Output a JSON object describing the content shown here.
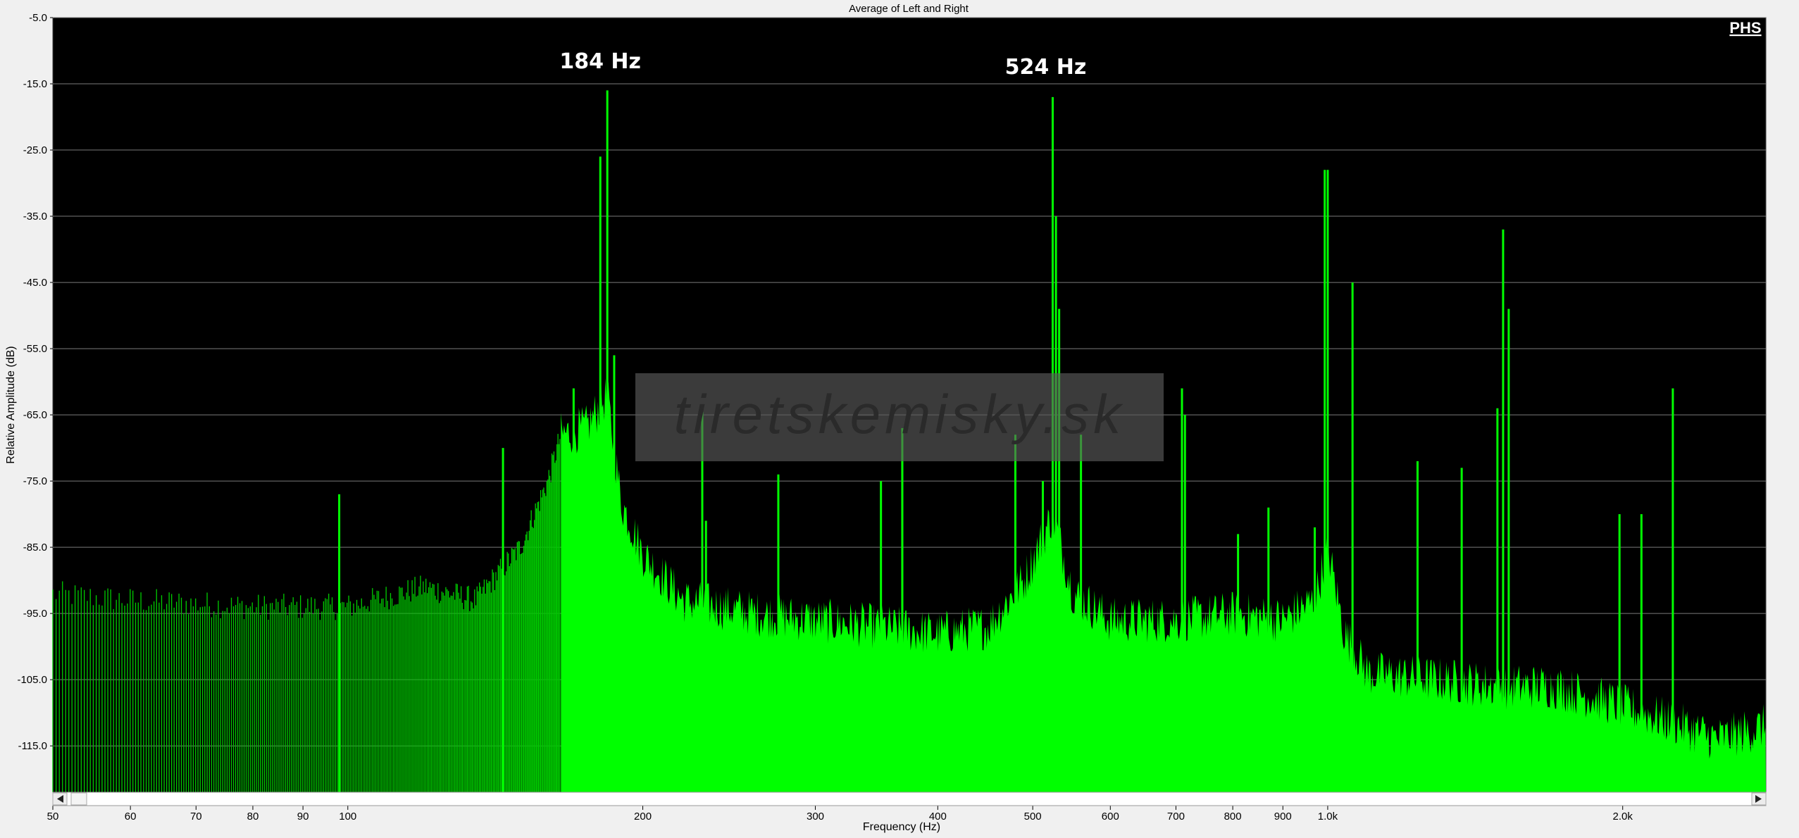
{
  "window": {
    "title": "Average of Left and Right"
  },
  "badge": "PHS",
  "watermark": "tiretskemisky.sk",
  "annotations": [
    {
      "text": "184 Hz",
      "x": 184
    },
    {
      "text": "524 Hz",
      "x": 524
    }
  ],
  "colors": {
    "plot_background": "#000000",
    "spectrum_fill": "#00ff00",
    "spectrum_low_region": "#00cc00",
    "grid": "#7a7a7a",
    "window_background": "#f0f0f0"
  },
  "chart_data": {
    "type": "area",
    "title": "Average of Left and Right",
    "xlabel": "Frequency (Hz)",
    "ylabel": "Relative Amplitude (dB)",
    "x_scale": "log",
    "xlim": [
      50,
      2800
    ],
    "ylim": [
      -122,
      -5
    ],
    "grid": true,
    "yticks": [
      -5,
      -15,
      -25,
      -35,
      -45,
      -55,
      -65,
      -75,
      -85,
      -95,
      -105,
      -115
    ],
    "ytick_labels": [
      "-5.0",
      "-15.0",
      "-25.0",
      "-35.0",
      "-45.0",
      "-55.0",
      "-65.0",
      "-75.0",
      "-85.0",
      "-95.0",
      "-105.0",
      "-115.0"
    ],
    "xticks": [
      50,
      60,
      70,
      80,
      90,
      100,
      200,
      300,
      400,
      500,
      600,
      700,
      800,
      900,
      1000,
      2000
    ],
    "xtick_labels": [
      "50",
      "60",
      "70",
      "80",
      "90",
      "100",
      "200",
      "300",
      "400",
      "500",
      "600",
      "700",
      "800",
      "900",
      "1.0k",
      "2.0k"
    ],
    "series": [
      {
        "name": "",
        "noise_floor": [
          [
            50,
            -92
          ],
          [
            60,
            -93
          ],
          [
            80,
            -94
          ],
          [
            100,
            -94
          ],
          [
            120,
            -91
          ],
          [
            135,
            -93
          ],
          [
            150,
            -85
          ],
          [
            160,
            -75
          ],
          [
            165,
            -68
          ],
          [
            175,
            -67
          ],
          [
            184,
            -62
          ],
          [
            190,
            -78
          ],
          [
            200,
            -86
          ],
          [
            220,
            -93
          ],
          [
            260,
            -95
          ],
          [
            300,
            -96
          ],
          [
            350,
            -97
          ],
          [
            400,
            -98
          ],
          [
            450,
            -97
          ],
          [
            490,
            -90
          ],
          [
            524,
            -80
          ],
          [
            550,
            -92
          ],
          [
            600,
            -96
          ],
          [
            700,
            -96
          ],
          [
            800,
            -95
          ],
          [
            900,
            -96
          ],
          [
            970,
            -93
          ],
          [
            1000,
            -85
          ],
          [
            1040,
            -98
          ],
          [
            1100,
            -104
          ],
          [
            1300,
            -105
          ],
          [
            1500,
            -106
          ],
          [
            1700,
            -106
          ],
          [
            1900,
            -108
          ],
          [
            2100,
            -110
          ],
          [
            2300,
            -112
          ],
          [
            2500,
            -114
          ],
          [
            2800,
            -112
          ]
        ],
        "peaks": [
          [
            98,
            -77
          ],
          [
            144,
            -70
          ],
          [
            170,
            -61
          ],
          [
            184,
            -16
          ],
          [
            181,
            -26
          ],
          [
            187,
            -56
          ],
          [
            230,
            -64
          ],
          [
            232,
            -81
          ],
          [
            275,
            -74
          ],
          [
            350,
            -75
          ],
          [
            368,
            -67
          ],
          [
            368,
            -71
          ],
          [
            480,
            -68
          ],
          [
            512,
            -75
          ],
          [
            524,
            -17
          ],
          [
            528,
            -35
          ],
          [
            532,
            -49
          ],
          [
            560,
            -68
          ],
          [
            710,
            -61
          ],
          [
            715,
            -65
          ],
          [
            810,
            -83
          ],
          [
            870,
            -79
          ],
          [
            970,
            -82
          ],
          [
            993,
            -28
          ],
          [
            1000,
            -28
          ],
          [
            1060,
            -45
          ],
          [
            1235,
            -72
          ],
          [
            1370,
            -73
          ],
          [
            1490,
            -64
          ],
          [
            1510,
            -37
          ],
          [
            1530,
            -49
          ],
          [
            1985,
            -80
          ],
          [
            2090,
            -80
          ],
          [
            2250,
            -61
          ]
        ]
      }
    ]
  }
}
